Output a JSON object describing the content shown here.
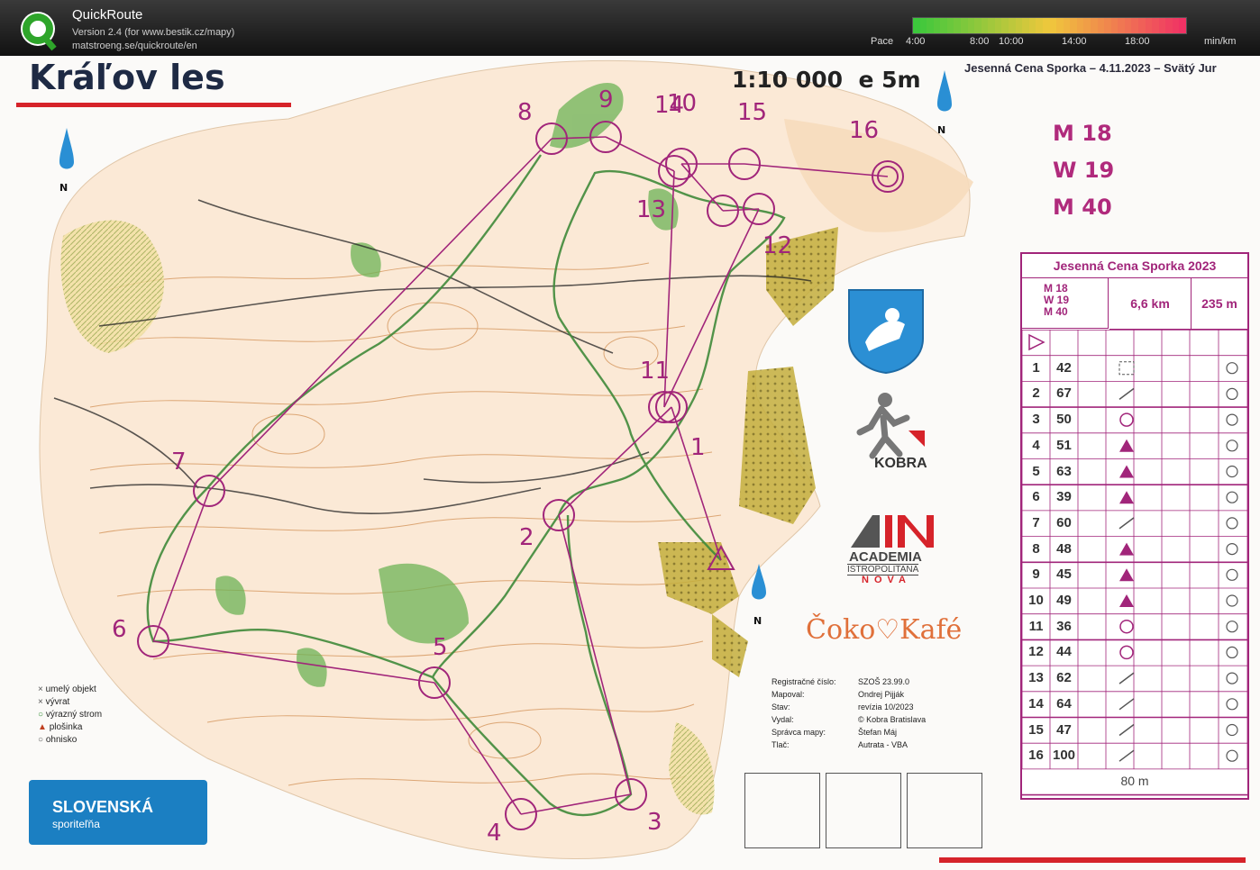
{
  "app": {
    "name": "QuickRoute",
    "version": "Version 2.4  (for www.bestik.cz/mapy)",
    "url": "matstroeng.se/quickroute/en"
  },
  "pace_scale": {
    "label": "Pace",
    "ticks": [
      "4:00",
      "8:00",
      "10:00",
      "14:00",
      "18:00"
    ],
    "unit": "min/km"
  },
  "map": {
    "title": "Kráľov les",
    "scale": "1:10 000",
    "contour": "e 5m",
    "event_header": "Jesenná Cena Sporka – 4.11.2023 – Svätý Jur",
    "classes": [
      "M 18",
      "W 19",
      "M 40"
    ],
    "north_label": "N",
    "control_numbers": [
      "1",
      "2",
      "3",
      "4",
      "5",
      "6",
      "7",
      "8",
      "9",
      "10",
      "11",
      "12",
      "13",
      "14",
      "15",
      "16"
    ],
    "description_sheet": {
      "title": "Jesenná Cena Sporka 2023",
      "classes": "M 18\nW 19\nM 40",
      "length": "6,6 km",
      "climb": "235 m",
      "controls": [
        {
          "no": "1",
          "code": "42"
        },
        {
          "no": "2",
          "code": "67"
        },
        {
          "no": "3",
          "code": "50"
        },
        {
          "no": "4",
          "code": "51"
        },
        {
          "no": "5",
          "code": "63"
        },
        {
          "no": "6",
          "code": "39"
        },
        {
          "no": "7",
          "code": "60"
        },
        {
          "no": "8",
          "code": "48"
        },
        {
          "no": "9",
          "code": "45"
        },
        {
          "no": "10",
          "code": "49"
        },
        {
          "no": "11",
          "code": "36"
        },
        {
          "no": "12",
          "code": "44"
        },
        {
          "no": "13",
          "code": "62"
        },
        {
          "no": "14",
          "code": "64"
        },
        {
          "no": "15",
          "code": "47"
        },
        {
          "no": "16",
          "code": "100"
        }
      ],
      "finish_distance": "80 m"
    },
    "legend": [
      "umelý objekt",
      "vývrat",
      "výrazný strom",
      "plošinka",
      "ohnisko"
    ],
    "info": {
      "labels": [
        "Registračné číslo:",
        "Mapoval:",
        "Stav:",
        "Vydal:",
        "Správca mapy:",
        "Tlač:"
      ],
      "values": [
        "SZOŠ 23.99.0",
        "Ondrej Pijják",
        "revízia 10/2023",
        "© Kobra Bratislava",
        "Štefan Máj",
        "Autrata - VBA"
      ]
    },
    "sponsors": {
      "club": "KOBRA",
      "academia_line1": "ACADEMIA",
      "academia_line2": "ISTROPOLITANA",
      "academia_line3": "NOVA",
      "cafe": "Čoko♡Kafé",
      "bank_line1": "SLOVENSKÁ",
      "bank_line2": "sporiteľňa"
    }
  },
  "colors": {
    "course": "#a1257a",
    "route": "#3f8a3a",
    "contour": "#c8742e",
    "vegetation": "#5aa646",
    "open_land": "#e9c84a"
  }
}
